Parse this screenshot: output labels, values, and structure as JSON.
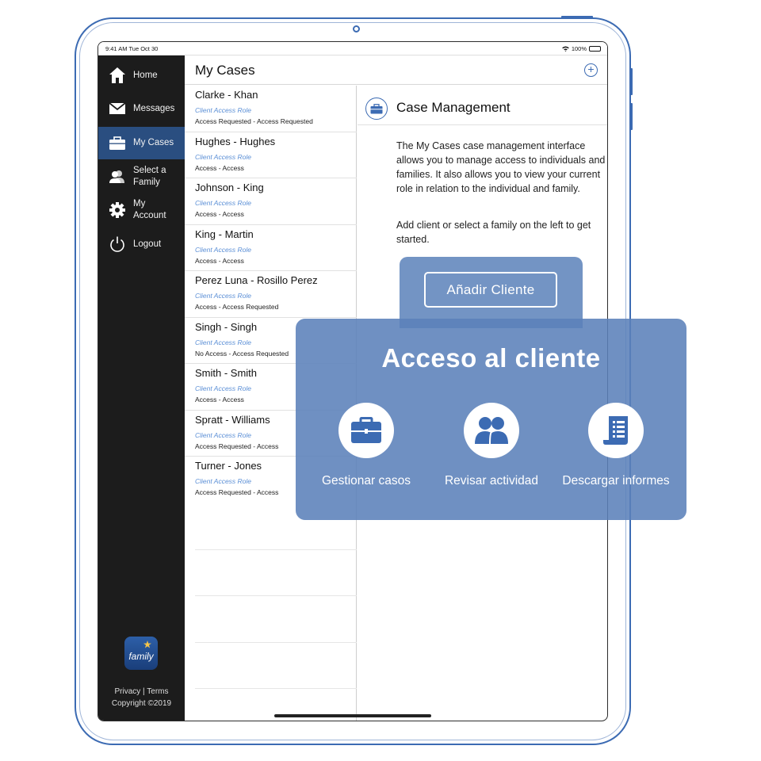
{
  "status_bar": {
    "time_date": "9:41 AM  Tue Oct 30",
    "battery": "100%"
  },
  "sidebar": {
    "items": [
      {
        "label": "Home",
        "icon": "home-icon"
      },
      {
        "label": "Messages",
        "icon": "envelope-icon"
      },
      {
        "label": "My Cases",
        "icon": "briefcase-icon",
        "active": true
      },
      {
        "label": "Select a Family",
        "icon": "people-icon"
      },
      {
        "label": "My Account",
        "icon": "gear-icon"
      },
      {
        "label": "Logout",
        "icon": "power-icon"
      }
    ],
    "logo_text": "family",
    "footer_links": "Privacy  |  Terms",
    "copyright": "Copyright ©2019"
  },
  "list": {
    "title": "My Cases",
    "add_label": "+",
    "cases": [
      {
        "name": "Clarke - Khan",
        "role": "Client Access Role",
        "access": "Access Requested - Access Requested"
      },
      {
        "name": "Hughes - Hughes",
        "role": "Client Access Role",
        "access": "Access - Access"
      },
      {
        "name": "Johnson - King",
        "role": "Client Access Role",
        "access": "Access - Access"
      },
      {
        "name": "King - Martin",
        "role": "Client Access Role",
        "access": "Access - Access"
      },
      {
        "name": "Perez Luna - Rosillo Perez",
        "role": "Client Access Role",
        "access": "Access - Access Requested"
      },
      {
        "name": "Singh - Singh",
        "role": "Client Access Role",
        "access": "No Access - Access Requested"
      },
      {
        "name": "Smith - Smith",
        "role": "Client Access Role",
        "access": "Access - Access"
      },
      {
        "name": "Spratt - Williams",
        "role": "Client Access Role",
        "access": "Access Requested - Access"
      },
      {
        "name": "Turner - Jones",
        "role": "Client Access Role",
        "access": "Access Requested - Access"
      }
    ]
  },
  "detail": {
    "title": "Case Management",
    "paragraph1": "The My Cases case management interface allows you to manage access to individuals and families.  It also allows you to view your current role in relation to the individual and family.",
    "paragraph2": "Add client or select a family on the left to get started."
  },
  "overlay": {
    "button_label": "Añadir Cliente",
    "title": "Acceso al cliente",
    "features": [
      {
        "label": "Gestionar casos",
        "icon": "briefcase-icon"
      },
      {
        "label": "Revisar actividad",
        "icon": "people-icon"
      },
      {
        "label": "Descargar informes",
        "icon": "document-icon"
      }
    ]
  },
  "colors": {
    "accent": "#3c6bb3",
    "sidebar_bg": "#1c1c1c",
    "sidebar_active": "#2a4e80",
    "overlay": "#5b81ba",
    "role_text": "#5b8fd6"
  }
}
